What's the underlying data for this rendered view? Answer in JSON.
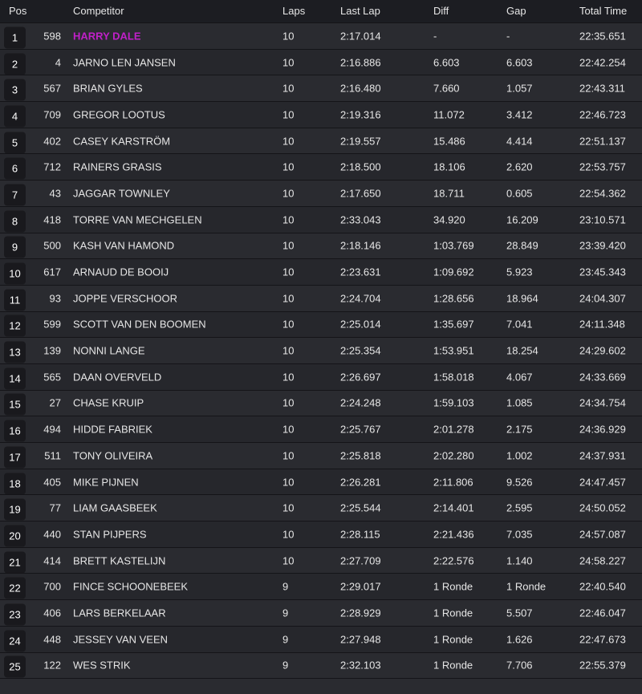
{
  "columns": {
    "pos": "Pos",
    "competitor": "Competitor",
    "laps": "Laps",
    "last_lap": "Last Lap",
    "diff": "Diff",
    "gap": "Gap",
    "total_time": "Total Time"
  },
  "highlight_color": "#c020c8",
  "rows": [
    {
      "pos": "1",
      "num": "598",
      "name": "HARRY DALE",
      "laps": "10",
      "last": "2:17.014",
      "diff": "-",
      "gap": "-",
      "total": "22:35.651",
      "highlight": true
    },
    {
      "pos": "2",
      "num": "4",
      "name": "JARNO LEN JANSEN",
      "laps": "10",
      "last": "2:16.886",
      "diff": "6.603",
      "gap": "6.603",
      "total": "22:42.254"
    },
    {
      "pos": "3",
      "num": "567",
      "name": "BRIAN GYLES",
      "laps": "10",
      "last": "2:16.480",
      "diff": "7.660",
      "gap": "1.057",
      "total": "22:43.311"
    },
    {
      "pos": "4",
      "num": "709",
      "name": "GREGOR LOOTUS",
      "laps": "10",
      "last": "2:19.316",
      "diff": "11.072",
      "gap": "3.412",
      "total": "22:46.723"
    },
    {
      "pos": "5",
      "num": "402",
      "name": "CASEY KARSTRÖM",
      "laps": "10",
      "last": "2:19.557",
      "diff": "15.486",
      "gap": "4.414",
      "total": "22:51.137"
    },
    {
      "pos": "6",
      "num": "712",
      "name": "RAINERS GRASIS",
      "laps": "10",
      "last": "2:18.500",
      "diff": "18.106",
      "gap": "2.620",
      "total": "22:53.757"
    },
    {
      "pos": "7",
      "num": "43",
      "name": "JAGGAR TOWNLEY",
      "laps": "10",
      "last": "2:17.650",
      "diff": "18.711",
      "gap": "0.605",
      "total": "22:54.362"
    },
    {
      "pos": "8",
      "num": "418",
      "name": "TORRE VAN MECHGELEN",
      "laps": "10",
      "last": "2:33.043",
      "diff": "34.920",
      "gap": "16.209",
      "total": "23:10.571"
    },
    {
      "pos": "9",
      "num": "500",
      "name": "KASH VAN HAMOND",
      "laps": "10",
      "last": "2:18.146",
      "diff": "1:03.769",
      "gap": "28.849",
      "total": "23:39.420"
    },
    {
      "pos": "10",
      "num": "617",
      "name": "ARNAUD DE BOOIJ",
      "laps": "10",
      "last": "2:23.631",
      "diff": "1:09.692",
      "gap": "5.923",
      "total": "23:45.343"
    },
    {
      "pos": "11",
      "num": "93",
      "name": "JOPPE VERSCHOOR",
      "laps": "10",
      "last": "2:24.704",
      "diff": "1:28.656",
      "gap": "18.964",
      "total": "24:04.307"
    },
    {
      "pos": "12",
      "num": "599",
      "name": "SCOTT VAN DEN BOOMEN",
      "laps": "10",
      "last": "2:25.014",
      "diff": "1:35.697",
      "gap": "7.041",
      "total": "24:11.348"
    },
    {
      "pos": "13",
      "num": "139",
      "name": "NONNI LANGE",
      "laps": "10",
      "last": "2:25.354",
      "diff": "1:53.951",
      "gap": "18.254",
      "total": "24:29.602"
    },
    {
      "pos": "14",
      "num": "565",
      "name": "DAAN OVERVELD",
      "laps": "10",
      "last": "2:26.697",
      "diff": "1:58.018",
      "gap": "4.067",
      "total": "24:33.669"
    },
    {
      "pos": "15",
      "num": "27",
      "name": "CHASE KRUIP",
      "laps": "10",
      "last": "2:24.248",
      "diff": "1:59.103",
      "gap": "1.085",
      "total": "24:34.754"
    },
    {
      "pos": "16",
      "num": "494",
      "name": "HIDDE FABRIEK",
      "laps": "10",
      "last": "2:25.767",
      "diff": "2:01.278",
      "gap": "2.175",
      "total": "24:36.929"
    },
    {
      "pos": "17",
      "num": "511",
      "name": "TONY OLIVEIRA",
      "laps": "10",
      "last": "2:25.818",
      "diff": "2:02.280",
      "gap": "1.002",
      "total": "24:37.931"
    },
    {
      "pos": "18",
      "num": "405",
      "name": "MIKE PIJNEN",
      "laps": "10",
      "last": "2:26.281",
      "diff": "2:11.806",
      "gap": "9.526",
      "total": "24:47.457"
    },
    {
      "pos": "19",
      "num": "77",
      "name": "LIAM GAASBEEK",
      "laps": "10",
      "last": "2:25.544",
      "diff": "2:14.401",
      "gap": "2.595",
      "total": "24:50.052"
    },
    {
      "pos": "20",
      "num": "440",
      "name": "STAN PIJPERS",
      "laps": "10",
      "last": "2:28.115",
      "diff": "2:21.436",
      "gap": "7.035",
      "total": "24:57.087"
    },
    {
      "pos": "21",
      "num": "414",
      "name": "BRETT KASTELIJN",
      "laps": "10",
      "last": "2:27.709",
      "diff": "2:22.576",
      "gap": "1.140",
      "total": "24:58.227"
    },
    {
      "pos": "22",
      "num": "700",
      "name": "FINCE SCHOONEBEEK",
      "laps": "9",
      "last": "2:29.017",
      "diff": "1 Ronde",
      "gap": "1 Ronde",
      "total": "22:40.540"
    },
    {
      "pos": "23",
      "num": "406",
      "name": "LARS BERKELAAR",
      "laps": "9",
      "last": "2:28.929",
      "diff": "1 Ronde",
      "gap": "5.507",
      "total": "22:46.047"
    },
    {
      "pos": "24",
      "num": "448",
      "name": "JESSEY VAN VEEN",
      "laps": "9",
      "last": "2:27.948",
      "diff": "1 Ronde",
      "gap": "1.626",
      "total": "22:47.673"
    },
    {
      "pos": "25",
      "num": "122",
      "name": "WES STRIK",
      "laps": "9",
      "last": "2:32.103",
      "diff": "1 Ronde",
      "gap": "7.706",
      "total": "22:55.379"
    }
  ]
}
